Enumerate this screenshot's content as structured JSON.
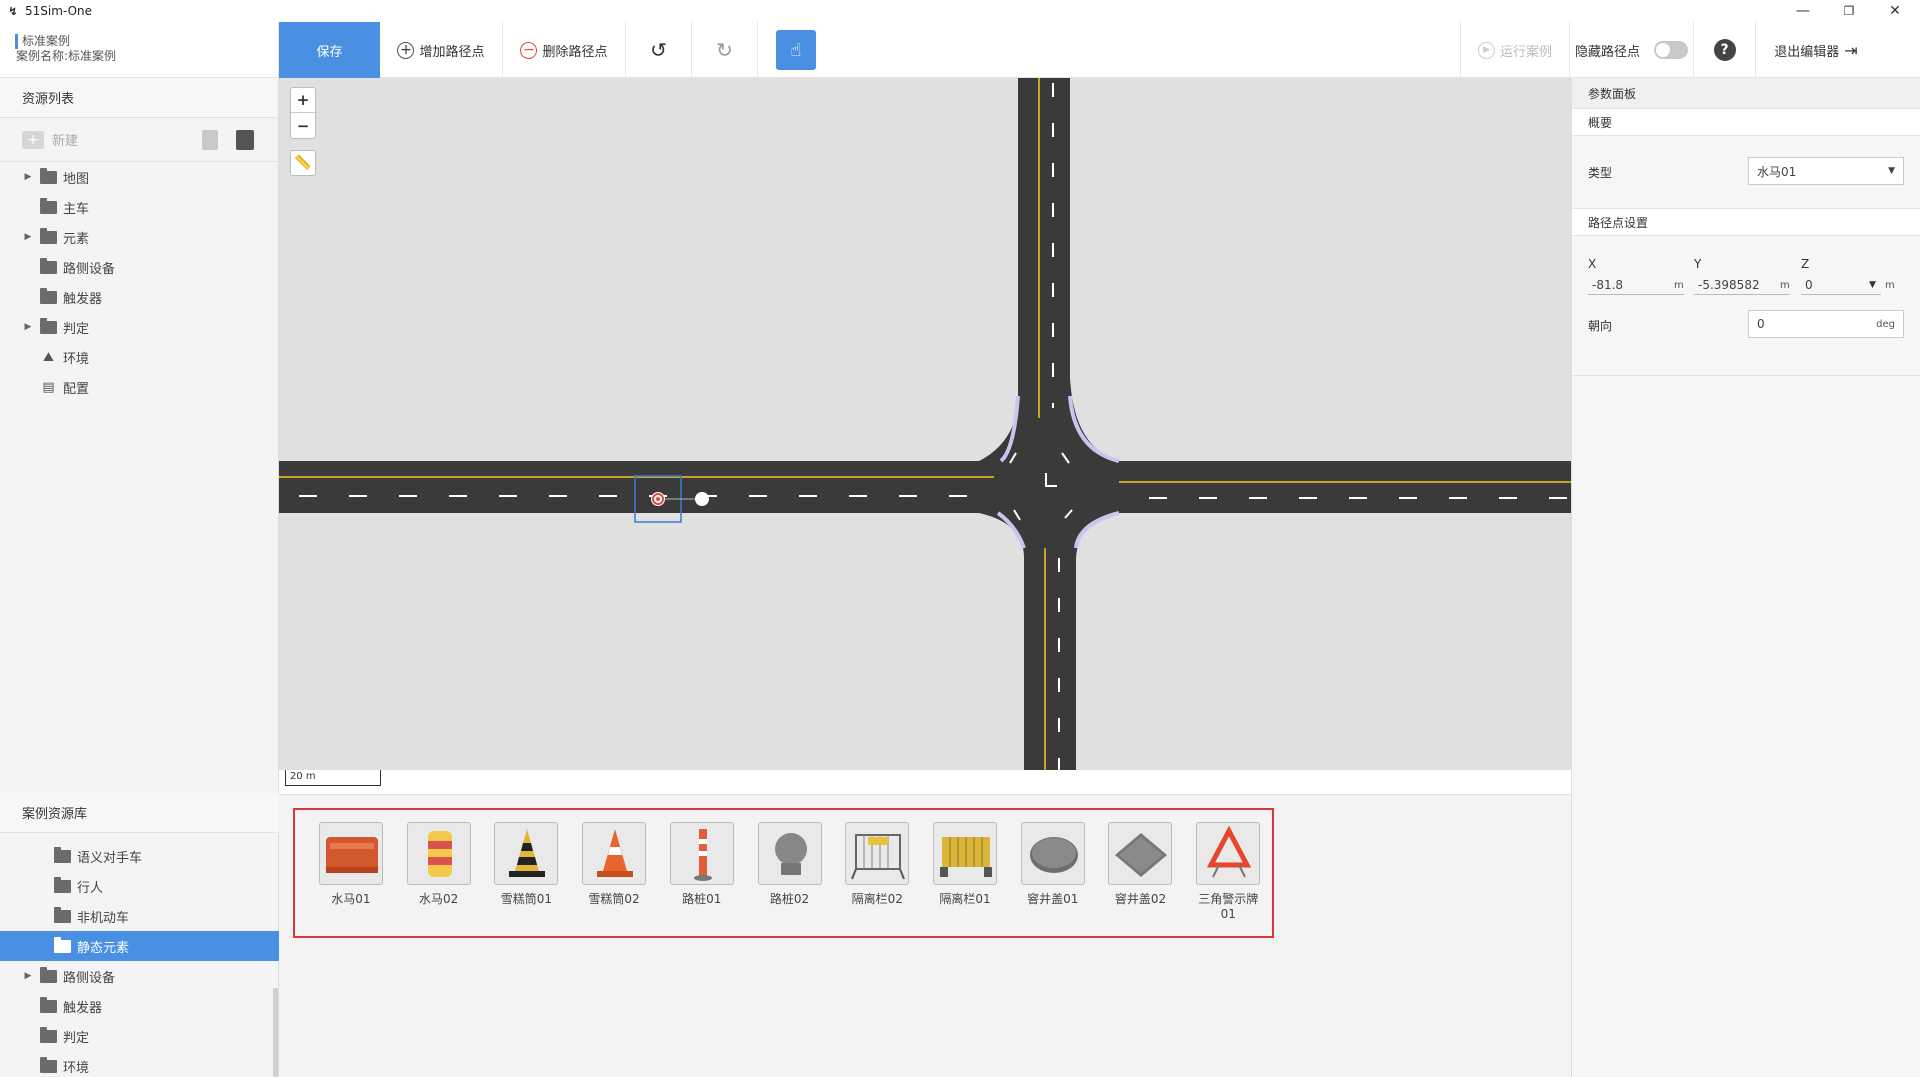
{
  "window": {
    "title": "51Sim-One",
    "minimize": "—",
    "restore": "❐",
    "close": "✕"
  },
  "header": {
    "case_tag": "标准案例",
    "case_name": "案例名称:标准案例"
  },
  "toolbar": {
    "save": "保存",
    "add_waypoint": "增加路径点",
    "delete_waypoint": "删除路径点",
    "run_case": "运行案例",
    "hide_waypoint": "隐藏路径点",
    "exit_editor": "退出编辑器",
    "hide_waypoint_on": false
  },
  "resource_list": {
    "title": "资源列表",
    "new_label": "新建",
    "items": [
      {
        "label": "地图",
        "expandable": true,
        "icon": "folder-icon"
      },
      {
        "label": "主车",
        "expandable": false,
        "icon": "folder-icon"
      },
      {
        "label": "元素",
        "expandable": true,
        "icon": "folder-icon"
      },
      {
        "label": "路侧设备",
        "expandable": false,
        "icon": "folder-icon"
      },
      {
        "label": "触发器",
        "expandable": false,
        "icon": "folder-icon"
      },
      {
        "label": "判定",
        "expandable": true,
        "icon": "folder-icon"
      },
      {
        "label": "环境",
        "expandable": false,
        "icon": "environment-icon"
      },
      {
        "label": "配置",
        "expandable": false,
        "icon": "config-icon"
      }
    ]
  },
  "case_library": {
    "title": "案例资源库",
    "items": [
      {
        "label": "语义对手车",
        "indent": 2,
        "expandable": false,
        "selected": false
      },
      {
        "label": "行人",
        "indent": 2,
        "expandable": false,
        "selected": false
      },
      {
        "label": "非机动车",
        "indent": 2,
        "expandable": false,
        "selected": false
      },
      {
        "label": "静态元素",
        "indent": 2,
        "expandable": false,
        "selected": true
      },
      {
        "label": "路侧设备",
        "indent": 1,
        "expandable": true,
        "selected": false
      },
      {
        "label": "触发器",
        "indent": 1,
        "expandable": false,
        "selected": false
      },
      {
        "label": "判定",
        "indent": 1,
        "expandable": false,
        "selected": false
      },
      {
        "label": "环境",
        "indent": 1,
        "expandable": false,
        "selected": false
      }
    ]
  },
  "map": {
    "zoom_in": "+",
    "zoom_out": "−",
    "scale": "20 m"
  },
  "assets": [
    {
      "label": "水马01",
      "icon": "water-barrier-orange-icon"
    },
    {
      "label": "水马02",
      "icon": "water-barrel-icon"
    },
    {
      "label": "雪糕筒01",
      "icon": "cone-black-yellow-icon"
    },
    {
      "label": "雪糕筒02",
      "icon": "cone-orange-icon"
    },
    {
      "label": "路桩01",
      "icon": "bollard-icon"
    },
    {
      "label": "路桩02",
      "icon": "stone-ball-icon"
    },
    {
      "label": "隔离栏02",
      "icon": "fence-white-icon"
    },
    {
      "label": "隔离栏01",
      "icon": "fence-yellow-icon"
    },
    {
      "label": "窨井盖01",
      "icon": "manhole-round-icon"
    },
    {
      "label": "窨井盖02",
      "icon": "manhole-square-icon"
    },
    {
      "label": "三角警示牌01",
      "icon": "warning-triangle-icon"
    }
  ],
  "params": {
    "title": "参数面板",
    "overview": "概要",
    "type_label": "类型",
    "type_value": "水马01",
    "waypoint_settings": "路径点设置",
    "x_label": "X",
    "y_label": "Y",
    "z_label": "Z",
    "x_value": "-81.8",
    "y_value": "-5.398582",
    "z_value": "0",
    "unit_m": "m",
    "heading_label": "朝向",
    "heading_value": "0",
    "unit_deg": "deg"
  },
  "colors": {
    "accent": "#4a90e2",
    "asset_border": "#d9373f",
    "road": "#3a3a3a",
    "lane_yellow": "#c9a227"
  }
}
